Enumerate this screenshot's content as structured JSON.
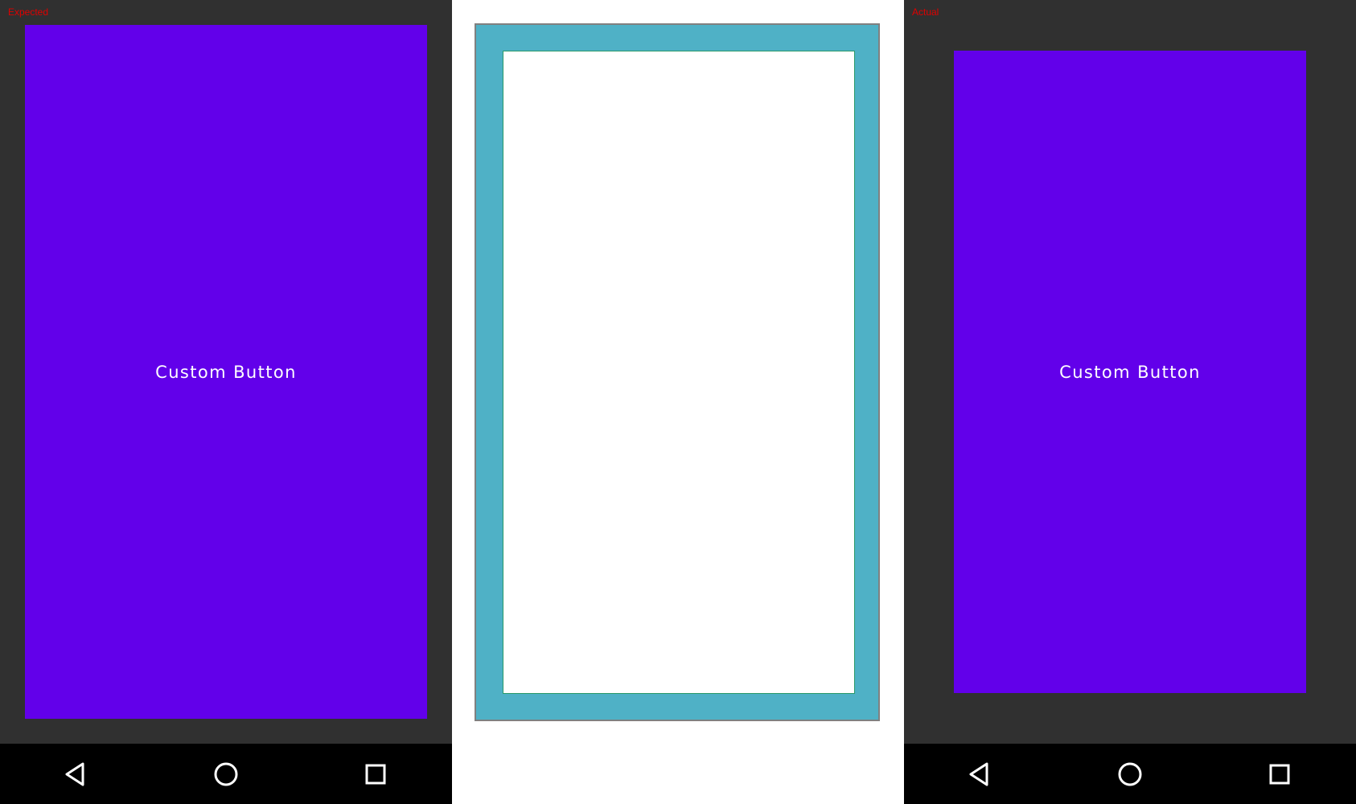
{
  "expected": {
    "label": "Expected",
    "button_text": "Custom Button"
  },
  "actual": {
    "label": "Actual",
    "button_text": "Custom Button"
  },
  "diff": {},
  "nav": {
    "back_icon": "back-triangle-icon",
    "home_icon": "home-circle-icon",
    "recents_icon": "recents-square-icon"
  },
  "colors": {
    "button": "#6200ea",
    "screen_bg": "#303030",
    "navbar": "#000000",
    "label": "#e00000",
    "diff_frame": "#4fb1c6"
  }
}
